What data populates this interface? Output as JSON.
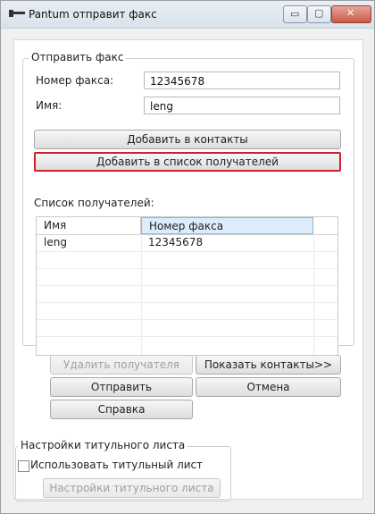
{
  "window": {
    "title": "Pantum отправит факс",
    "min_glyph": "▭",
    "max_glyph": "▢",
    "close_glyph": "✕"
  },
  "send_fax": {
    "group_title": "Отправить факс",
    "fax_number_label": "Номер факса:",
    "fax_number_value": "12345678",
    "name_label": "Имя:",
    "name_value": "leng",
    "add_to_contacts_label": "Добавить в контакты",
    "add_to_recipients_label": "Добавить в список получателей"
  },
  "recipients": {
    "list_label": "Список получателей:",
    "columns": [
      "Имя",
      "Номер факса"
    ],
    "rows": [
      {
        "name": "leng",
        "number": "12345678"
      }
    ]
  },
  "actions": {
    "delete_recipient_label": "Удалить получателя",
    "show_contacts_label": "Показать контакты>>",
    "send_label": "Отправить",
    "cancel_label": "Отмена",
    "help_label": "Справка"
  },
  "cover_page": {
    "group_title": "Настройки титульного листа",
    "use_cover_label": "Использовать титульный лист",
    "use_cover_checked": false,
    "cover_settings_label": "Настройки титульного листа"
  },
  "colors": {
    "highlight_border": "#d11f2a",
    "selected_header": "#dcecfa"
  }
}
